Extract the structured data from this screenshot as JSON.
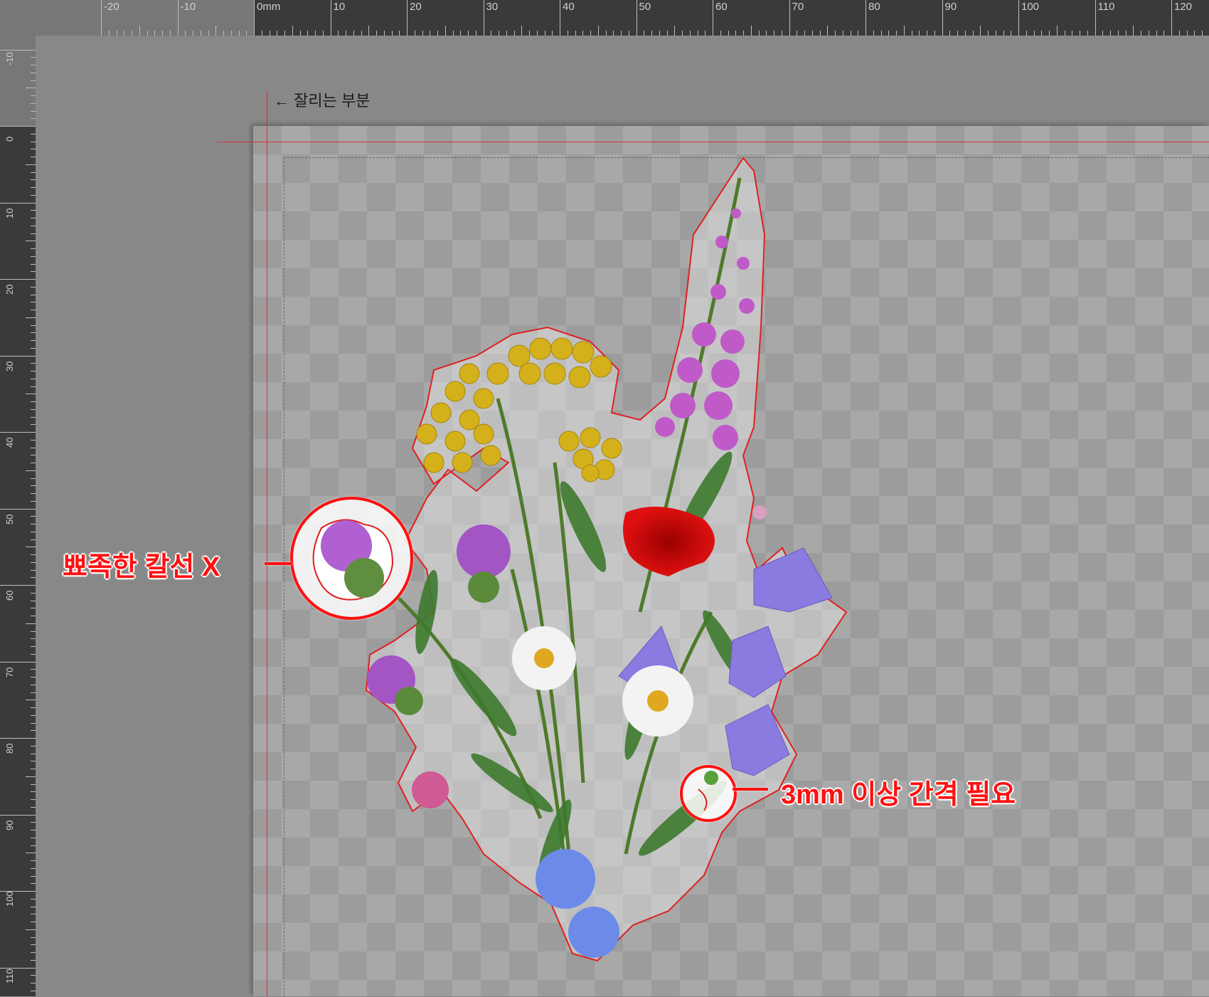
{
  "rulers": {
    "top_labels": [
      "-20",
      "-10",
      "0mm",
      "10",
      "20",
      "30",
      "40",
      "50",
      "60",
      "70",
      "80",
      "90",
      "100",
      "110",
      "120"
    ],
    "left_labels": [
      "-10",
      "0",
      "10",
      "20",
      "30",
      "40",
      "50",
      "60",
      "70",
      "80",
      "90",
      "100",
      "110"
    ]
  },
  "canvas": {
    "cut_label": "← 잘리는 부분"
  },
  "callouts": {
    "sharp_cut": "뾰족한 칼선 X",
    "gap_required": "3mm 이상 간격 필요"
  },
  "artwork": {
    "name": "wildflower-bouquet-sticker",
    "cut_line_color": "#e02020"
  }
}
